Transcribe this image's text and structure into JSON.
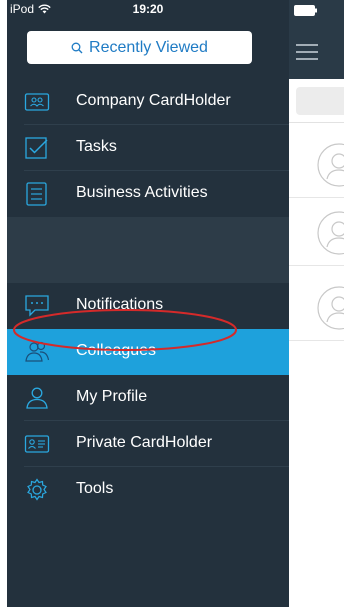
{
  "status_bar": {
    "carrier": "iPod",
    "time": "19:20"
  },
  "search": {
    "label": "Recently Viewed"
  },
  "menu": {
    "items": [
      {
        "label": "Company CardHolder",
        "icon": "contacts-card-icon"
      },
      {
        "label": "Tasks",
        "icon": "checkbox-icon"
      },
      {
        "label": "Business Activities",
        "icon": "list-icon"
      },
      {
        "label": "Notifications",
        "icon": "chat-bubble-icon"
      },
      {
        "label": "Colleagues",
        "icon": "colleagues-icon",
        "active": true
      },
      {
        "label": "My Profile",
        "icon": "person-icon"
      },
      {
        "label": "Private CardHolder",
        "icon": "id-card-icon"
      },
      {
        "label": "Tools",
        "icon": "gear-icon"
      }
    ]
  },
  "colors": {
    "sidebar_bg": "#23313d",
    "active_bg": "#1ea1dc",
    "icon_color": "#2aa8e0",
    "highlight_ellipse": "#d42a2a"
  }
}
